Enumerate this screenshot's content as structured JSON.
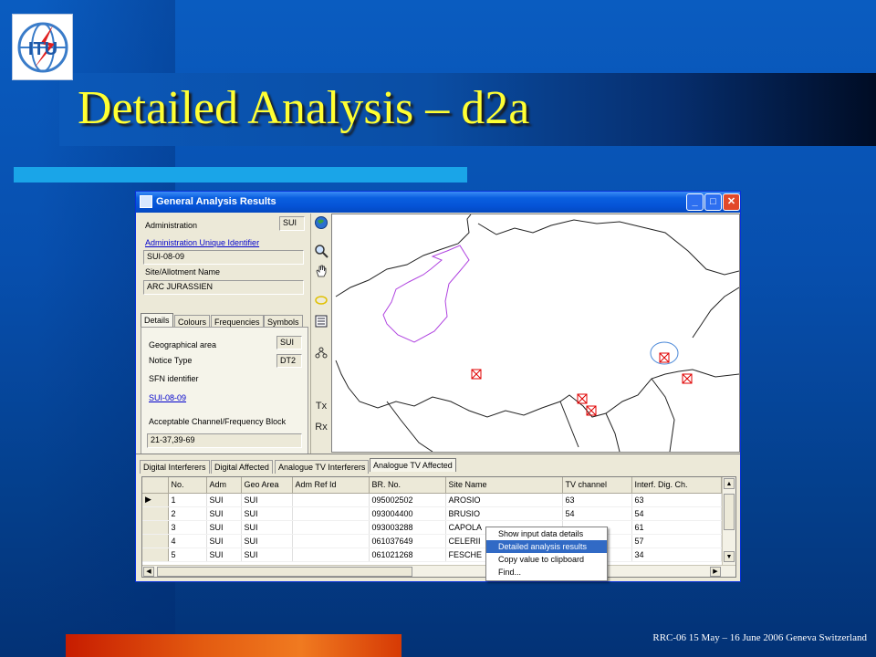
{
  "slide": {
    "title": "Detailed Analysis – d2a",
    "footer": "RRC-06 15 May – 16 June 2006 Geneva Switzerland",
    "logo_text": "ITU"
  },
  "window": {
    "title": "General Analysis Results"
  },
  "left_panel": {
    "administration_label": "Administration",
    "administration_value": "SUI",
    "admin_uid_label": "Administration Unique Identifier",
    "admin_uid_value": "SUI-08-09",
    "site_label": "Site/Allotment Name",
    "site_value": "ARC JURASSIEN",
    "tabs": [
      "Details",
      "Colours",
      "Frequencies",
      "Symbols"
    ],
    "geo_area_label": "Geographical area",
    "geo_area_value": "SUI",
    "notice_type_label": "Notice Type",
    "notice_type_value": "DT2",
    "sfn_label": "SFN identifier",
    "sfn_value": "SUI-08-09",
    "channel_label": "Acceptable Channel/Frequency Block",
    "channel_value": "21-37,39-69"
  },
  "toolbar": {
    "tx_label": "Tx",
    "rx_label": "Rx"
  },
  "bottom_tabs": [
    "Digital Interferers",
    "Digital Affected",
    "Analogue TV Interferers",
    "Analogue TV Affected"
  ],
  "table": {
    "headers": [
      "No.",
      "Adm",
      "Geo Area",
      "Adm Ref Id",
      "BR. No.",
      "Site Name",
      "TV channel",
      "Interf. Dig. Ch."
    ],
    "rows": [
      [
        "1",
        "SUI",
        "SUI",
        "",
        "095002502",
        "AROSIO",
        "63",
        "63"
      ],
      [
        "2",
        "SUI",
        "SUI",
        "",
        "093004400",
        "BRUSIO",
        "54",
        "54"
      ],
      [
        "3",
        "SUI",
        "SUI",
        "",
        "093003288",
        "CAPOLA",
        "",
        "61"
      ],
      [
        "4",
        "SUI",
        "SUI",
        "",
        "061037649",
        "CELERII",
        "",
        "57"
      ],
      [
        "5",
        "SUI",
        "SUI",
        "",
        "061021268",
        "FESCHE",
        "",
        "34"
      ]
    ],
    "current_row_marker": "▶"
  },
  "context_menu": {
    "items": [
      "Show input data details",
      "Detailed analysis results",
      "Copy value to clipboard",
      "Find..."
    ],
    "highlighted": "Detailed analysis results"
  },
  "colors": {
    "title": "#ffff33",
    "marker": "#e00000",
    "border_outline": "#b044e0"
  }
}
